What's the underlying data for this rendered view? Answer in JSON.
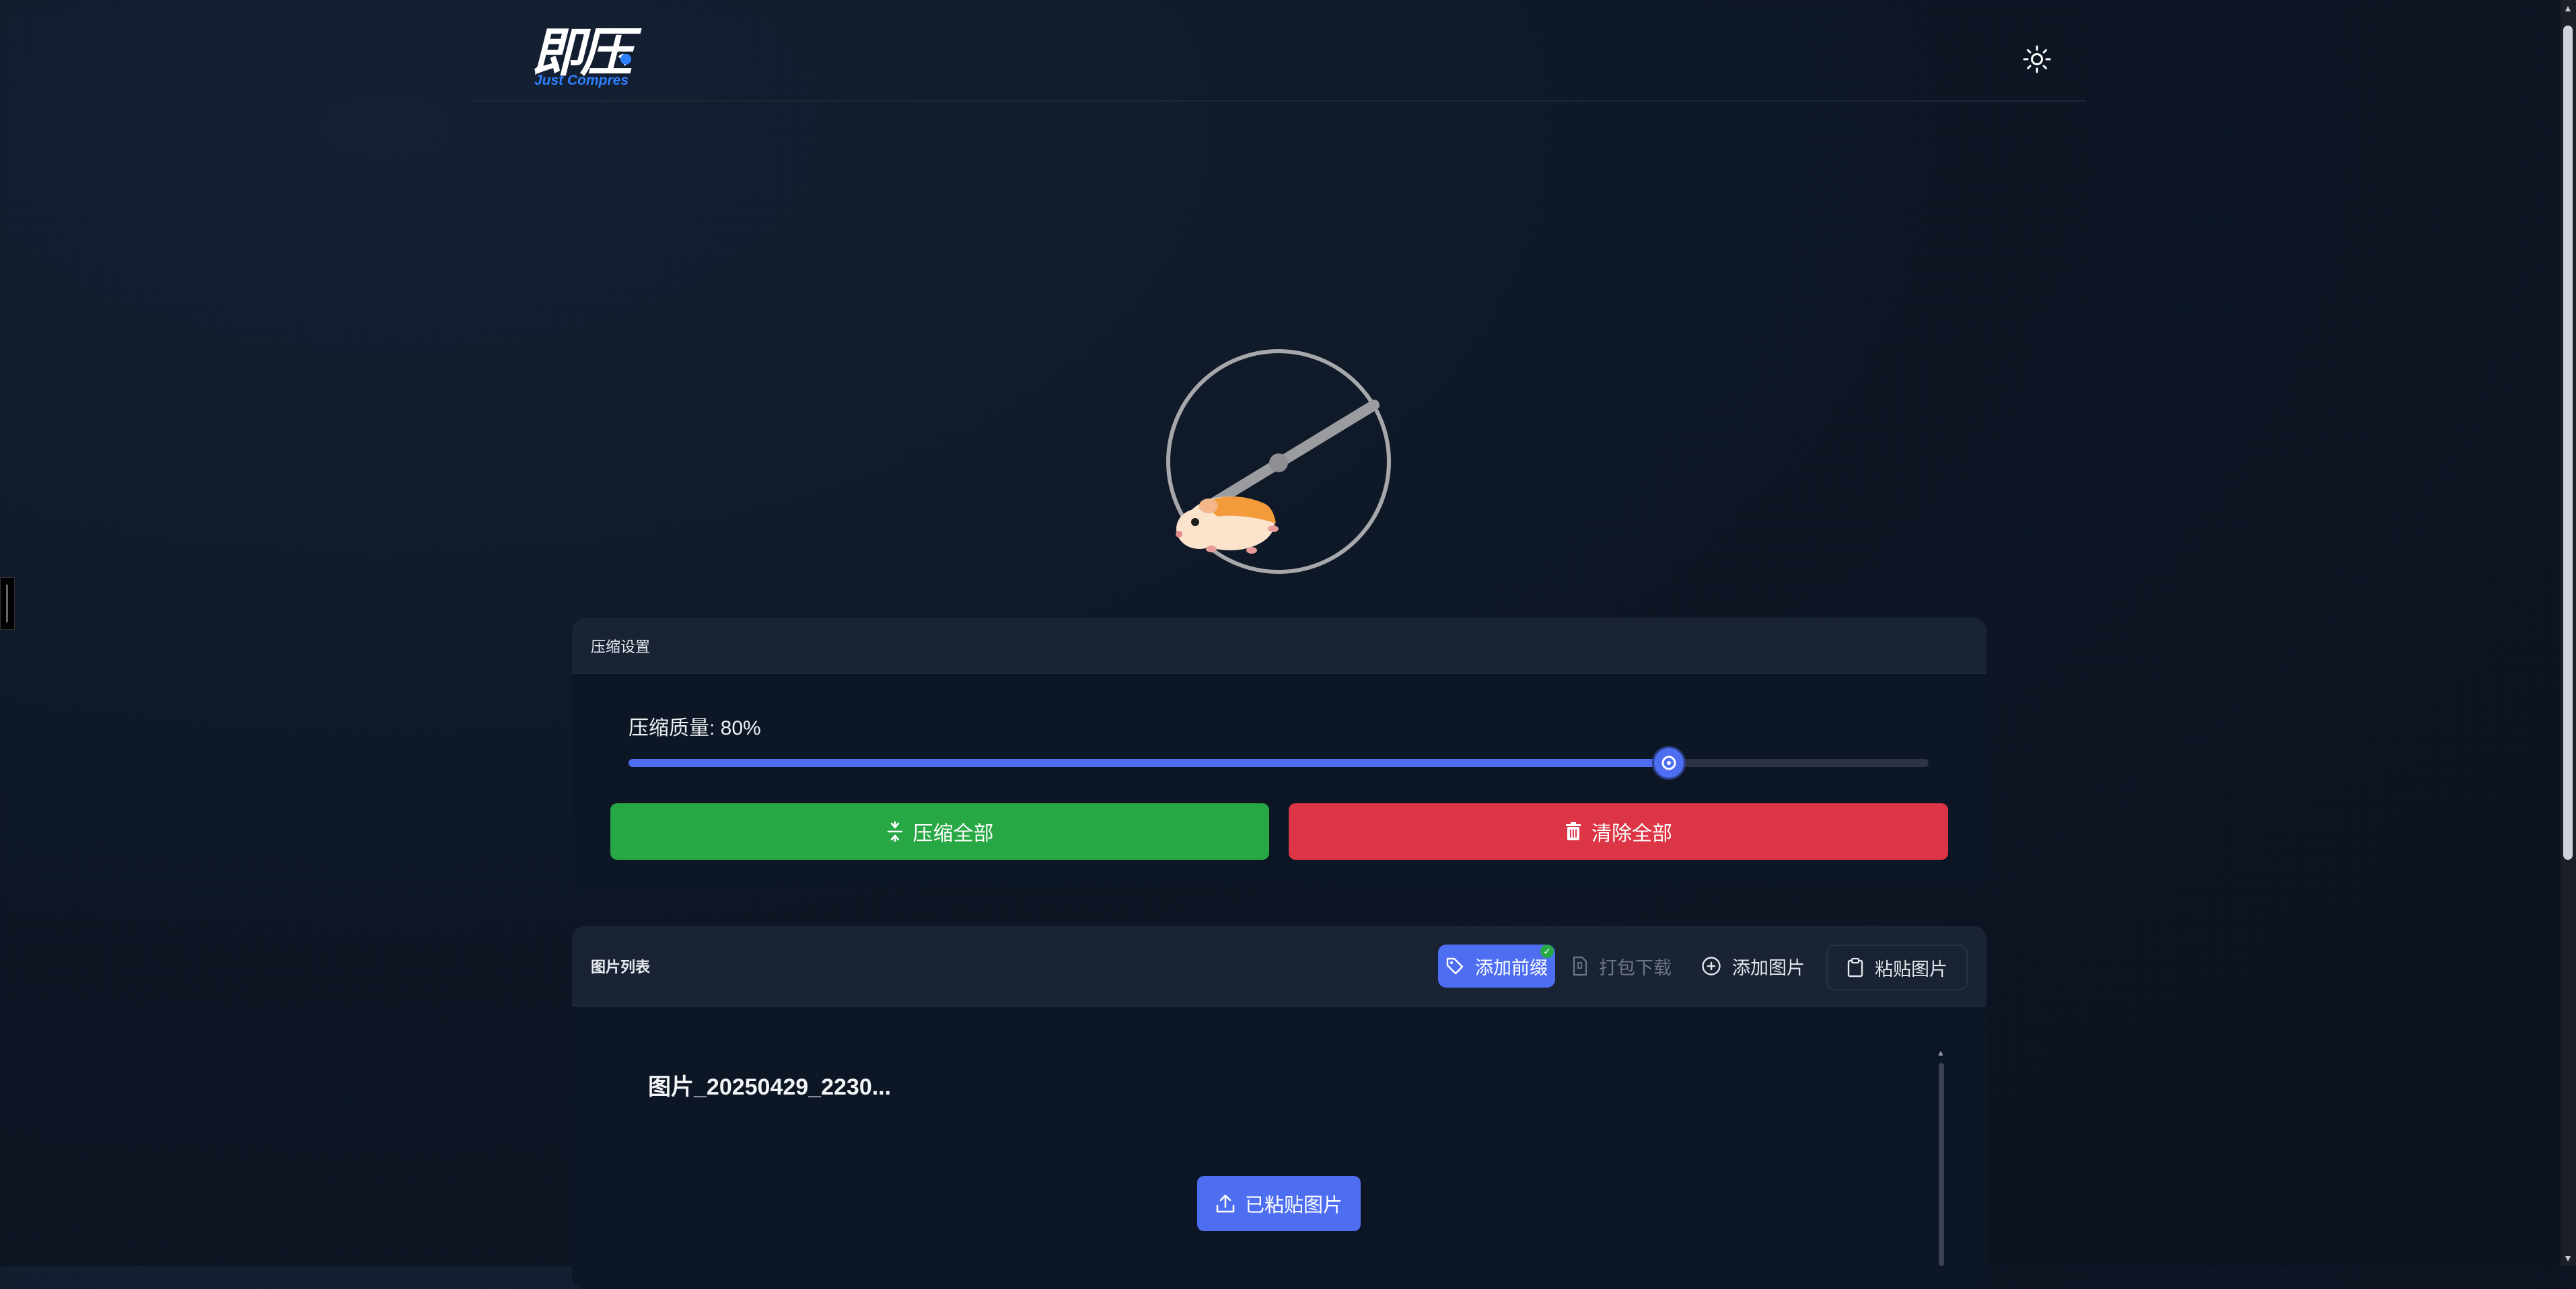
{
  "app": {
    "logo_cn": "即压",
    "logo_en": "Just Compres"
  },
  "header": {
    "theme_toggle_icon": "sun-icon"
  },
  "settings": {
    "title": "压缩设置",
    "quality_label": "压缩质量: 80%",
    "quality_value": 0.8,
    "compress_all_label": "压缩全部",
    "compress_all_icon": "compress-icon",
    "clear_all_label": "清除全部",
    "clear_all_icon": "trash-icon",
    "compress_color": "#28a745",
    "clear_color": "#dc3545",
    "accent_color": "#4e6ef2"
  },
  "image_list": {
    "title": "图片列表",
    "toolbar": {
      "add_prefix_label": "添加前缀",
      "add_prefix_icon": "tag-icon",
      "download_zip_label": "打包下载",
      "download_zip_icon": "zip-file-icon",
      "add_image_label": "添加图片",
      "add_image_icon": "plus-circle-icon",
      "paste_image_label": "粘贴图片",
      "paste_image_icon": "clipboard-icon"
    },
    "items": [
      {
        "name": "图片_20250429_2230..."
      }
    ]
  },
  "floating": {
    "pasted_label": "已粘贴图片",
    "pasted_icon": "upload-icon"
  }
}
